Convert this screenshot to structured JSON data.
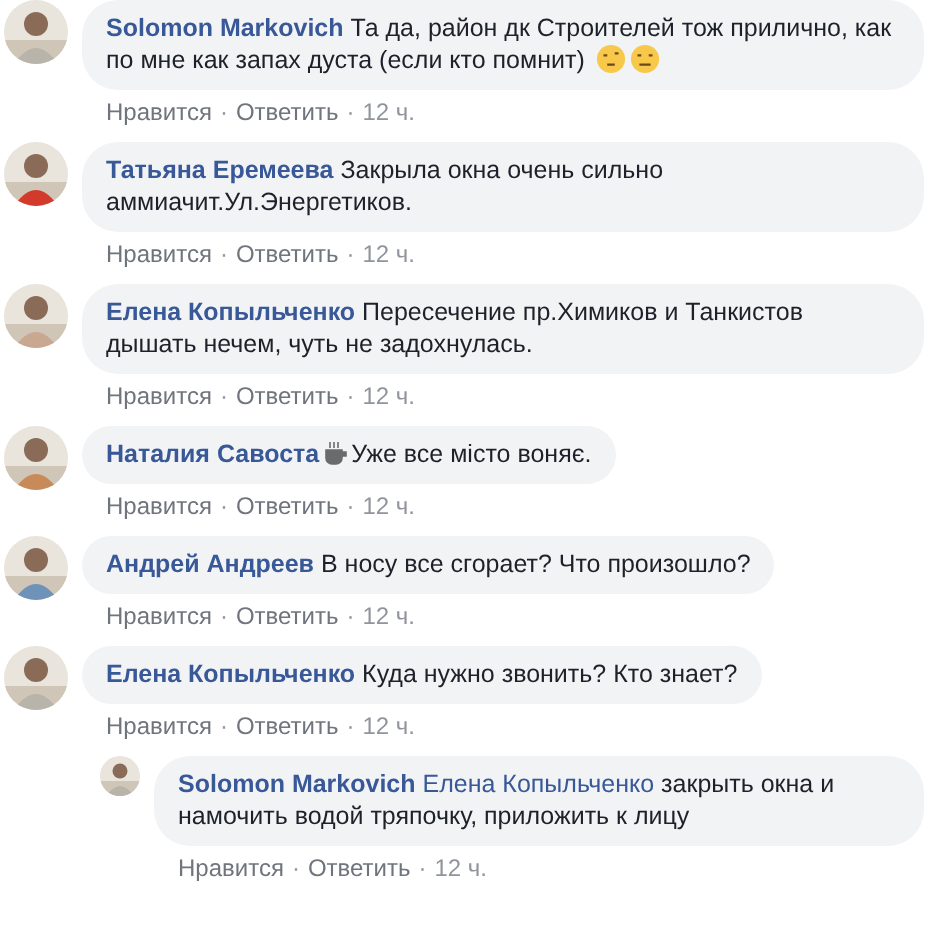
{
  "comments": [
    {
      "author": "Solomon Markovich",
      "text": "Та да, район дк Строителей тож прилично, как по мне как запах дуста (если кто помнит)",
      "emoji_after": true,
      "cup_after_name": false,
      "actions": [
        {
          "kind": "link",
          "label": "Нравится"
        },
        {
          "kind": "separator",
          "label": "·"
        },
        {
          "kind": "link",
          "label": "Ответить"
        },
        {
          "kind": "separator",
          "label": "·"
        },
        {
          "kind": "time",
          "label": "12 ч."
        }
      ]
    },
    {
      "author": "Татьяна Еремеева",
      "text": "Закрыла окна очень сильно аммиачит.Ул.Энергетиков.",
      "emoji_after": false,
      "cup_after_name": false,
      "actions": [
        {
          "kind": "link",
          "label": "Нравится"
        },
        {
          "kind": "separator",
          "label": "·"
        },
        {
          "kind": "link",
          "label": "Ответить"
        },
        {
          "kind": "separator",
          "label": "·"
        },
        {
          "kind": "time",
          "label": "12 ч."
        }
      ]
    },
    {
      "author": "Елена Копыльченко",
      "text": "Пересечение пр.Химиков и Танкистов дышать нечем, чуть не задохнулась.",
      "emoji_after": false,
      "cup_after_name": false,
      "actions": [
        {
          "kind": "link",
          "label": "Нравится"
        },
        {
          "kind": "separator",
          "label": "·"
        },
        {
          "kind": "link",
          "label": "Ответить"
        },
        {
          "kind": "separator",
          "label": "·"
        },
        {
          "kind": "time",
          "label": "12 ч."
        }
      ]
    },
    {
      "author": "Наталия Савоста",
      "text": "Уже все місто воняє.",
      "emoji_after": false,
      "cup_after_name": true,
      "actions": [
        {
          "kind": "link",
          "label": "Нравится"
        },
        {
          "kind": "separator",
          "label": "·"
        },
        {
          "kind": "link",
          "label": "Ответить"
        },
        {
          "kind": "separator",
          "label": "·"
        },
        {
          "kind": "time",
          "label": "12 ч."
        }
      ]
    },
    {
      "author": "Андрей Андреев",
      "text": "В носу все сгорает? Что произошло?",
      "emoji_after": false,
      "cup_after_name": false,
      "actions": [
        {
          "kind": "link",
          "label": "Нравится"
        },
        {
          "kind": "separator",
          "label": "·"
        },
        {
          "kind": "link",
          "label": "Ответить"
        },
        {
          "kind": "separator",
          "label": "·"
        },
        {
          "kind": "time",
          "label": "12 ч."
        }
      ]
    },
    {
      "author": "Елена Копыльченко",
      "text": "Куда нужно звонить? Кто знает?",
      "emoji_after": false,
      "cup_after_name": false,
      "actions": [
        {
          "kind": "link",
          "label": "Нравится"
        },
        {
          "kind": "separator",
          "label": "·"
        },
        {
          "kind": "link",
          "label": "Ответить"
        },
        {
          "kind": "separator",
          "label": "·"
        },
        {
          "kind": "time",
          "label": "12 ч."
        }
      ],
      "children": [
        {
          "author": "Solomon Markovich",
          "mention": "Елена Копыльченко",
          "text": "закрыть окна и намочить водой тряпочку, приложить к лицу",
          "emoji_after": false,
          "cup_after_name": false,
          "actions": [
            {
              "kind": "link",
              "label": "Нравится"
            },
            {
              "kind": "separator",
              "label": "·"
            },
            {
              "kind": "link",
              "label": "Ответить"
            },
            {
              "kind": "separator",
              "label": "·"
            },
            {
              "kind": "time",
              "label": "12 ч."
            }
          ]
        }
      ]
    }
  ]
}
